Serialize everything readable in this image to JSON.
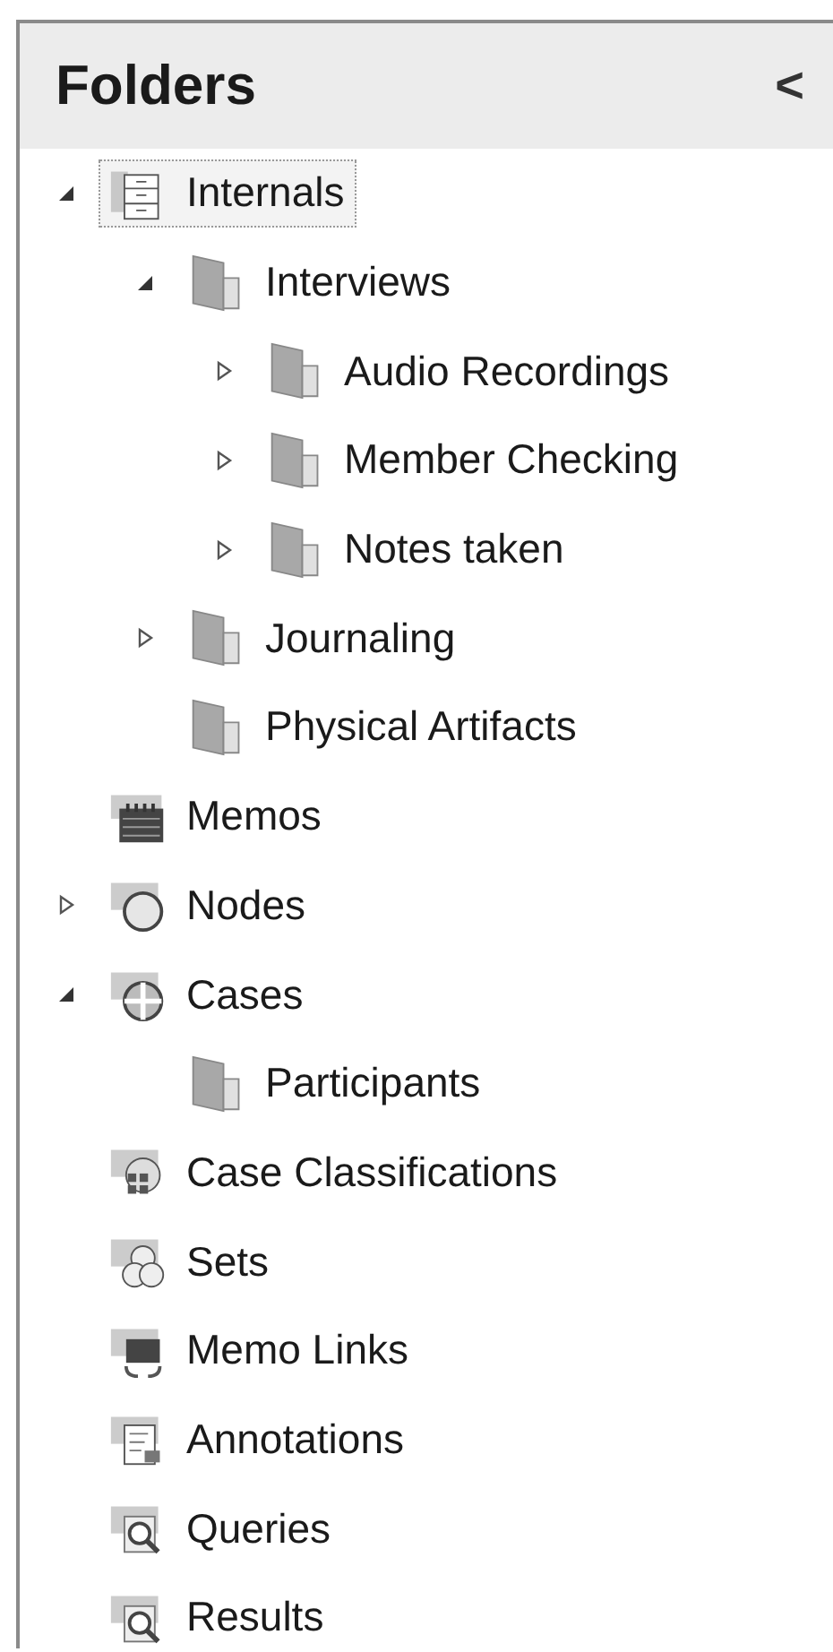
{
  "panel": {
    "title": "Folders",
    "collapse_glyph": "<"
  },
  "tree": [
    {
      "label": "Internals",
      "kind": "cabinet",
      "selected": true,
      "expanded": true,
      "children": [
        {
          "label": "Interviews",
          "kind": "folder",
          "selected": false,
          "expanded": true,
          "children": [
            {
              "label": "Audio Recordings",
              "kind": "folder",
              "selected": false,
              "expanded": false
            },
            {
              "label": "Member Checking",
              "kind": "folder",
              "selected": false,
              "expanded": false
            },
            {
              "label": "Notes taken",
              "kind": "folder",
              "selected": false,
              "expanded": false
            }
          ]
        },
        {
          "label": "Journaling",
          "kind": "folder",
          "selected": false,
          "expanded": false
        },
        {
          "label": "Physical Artifacts",
          "kind": "folder",
          "selected": false
        }
      ]
    },
    {
      "label": "Memos",
      "kind": "memos",
      "selected": false
    },
    {
      "label": "Nodes",
      "kind": "nodes",
      "selected": false,
      "expanded": false
    },
    {
      "label": "Cases",
      "kind": "cases",
      "selected": false,
      "expanded": true,
      "children": [
        {
          "label": "Participants",
          "kind": "folder",
          "selected": false
        }
      ]
    },
    {
      "label": "Case Classifications",
      "kind": "classifications",
      "selected": false
    },
    {
      "label": "Sets",
      "kind": "sets",
      "selected": false
    },
    {
      "label": "Memo Links",
      "kind": "memo-links",
      "selected": false
    },
    {
      "label": "Annotations",
      "kind": "annotations",
      "selected": false
    },
    {
      "label": "Queries",
      "kind": "queries",
      "selected": false
    },
    {
      "label": "Results",
      "kind": "results",
      "selected": false
    }
  ]
}
